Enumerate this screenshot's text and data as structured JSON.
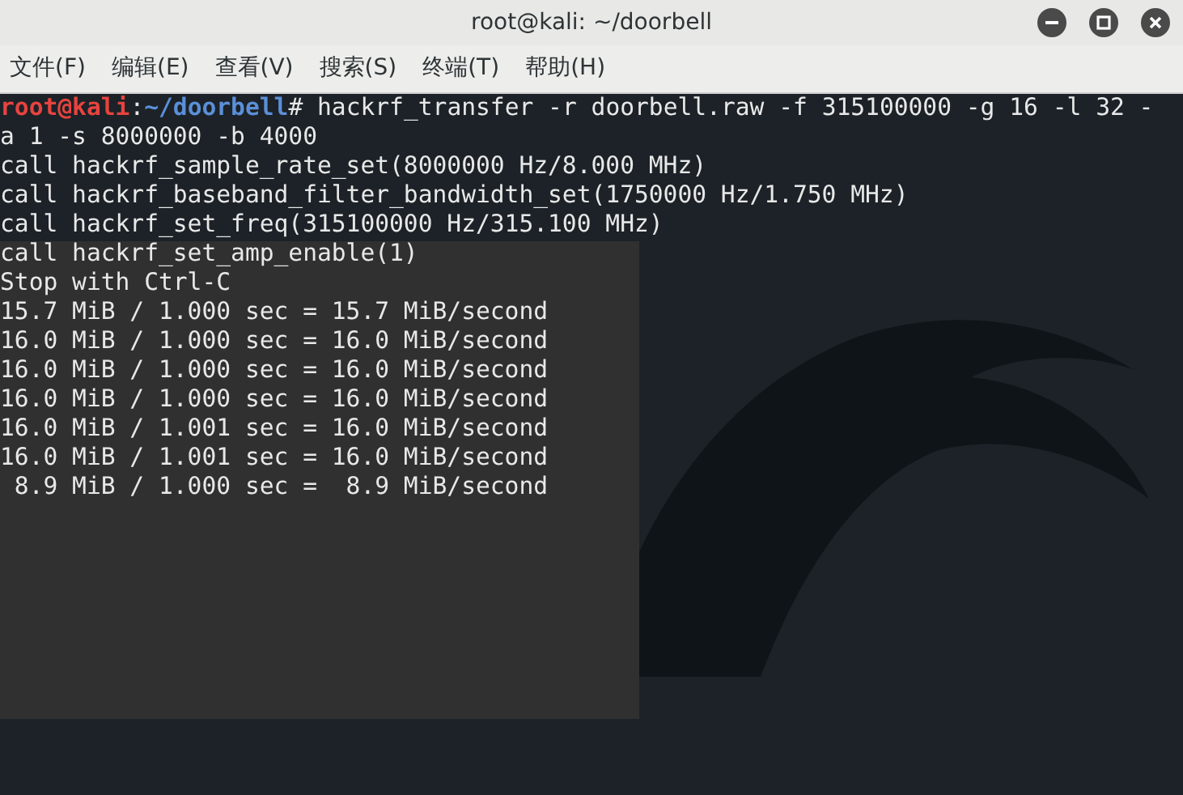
{
  "window": {
    "title": "root@kali: ~/doorbell"
  },
  "menu": [
    "文件(F)",
    "编辑(E)",
    "查看(V)",
    "搜索(S)",
    "终端(T)",
    "帮助(H)"
  ],
  "terminal": {
    "lines": [
      {
        "kind": "prompt",
        "user": "root@kali",
        "separator": ":",
        "path": "~/doorbell",
        "symbol": "#",
        "command": " hackrf_transfer -r doorbell.raw -f 315100000 -g 16 -l 32 -"
      },
      {
        "kind": "output",
        "text": "a 1 -s 8000000 -b 4000"
      },
      {
        "kind": "output",
        "text": "call hackrf_sample_rate_set(8000000 Hz/8.000 MHz)"
      },
      {
        "kind": "output",
        "text": "call hackrf_baseband_filter_bandwidth_set(1750000 Hz/1.750 MHz)"
      },
      {
        "kind": "output",
        "text": "call hackrf_set_freq(315100000 Hz/315.100 MHz)"
      },
      {
        "kind": "output",
        "text": "call hackrf_set_amp_enable(1)"
      },
      {
        "kind": "output",
        "text": "Stop with Ctrl-C"
      },
      {
        "kind": "output",
        "text": "15.7 MiB / 1.000 sec = 15.7 MiB/second"
      },
      {
        "kind": "output",
        "text": "16.0 MiB / 1.000 sec = 16.0 MiB/second"
      },
      {
        "kind": "output",
        "text": "16.0 MiB / 1.000 sec = 16.0 MiB/second"
      },
      {
        "kind": "output",
        "text": "16.0 MiB / 1.000 sec = 16.0 MiB/second"
      },
      {
        "kind": "output",
        "text": "16.0 MiB / 1.001 sec = 16.0 MiB/second"
      },
      {
        "kind": "output",
        "text": "16.0 MiB / 1.001 sec = 16.0 MiB/second"
      },
      {
        "kind": "output",
        "text": " 8.9 MiB / 1.000 sec =  8.9 MiB/second"
      }
    ]
  }
}
